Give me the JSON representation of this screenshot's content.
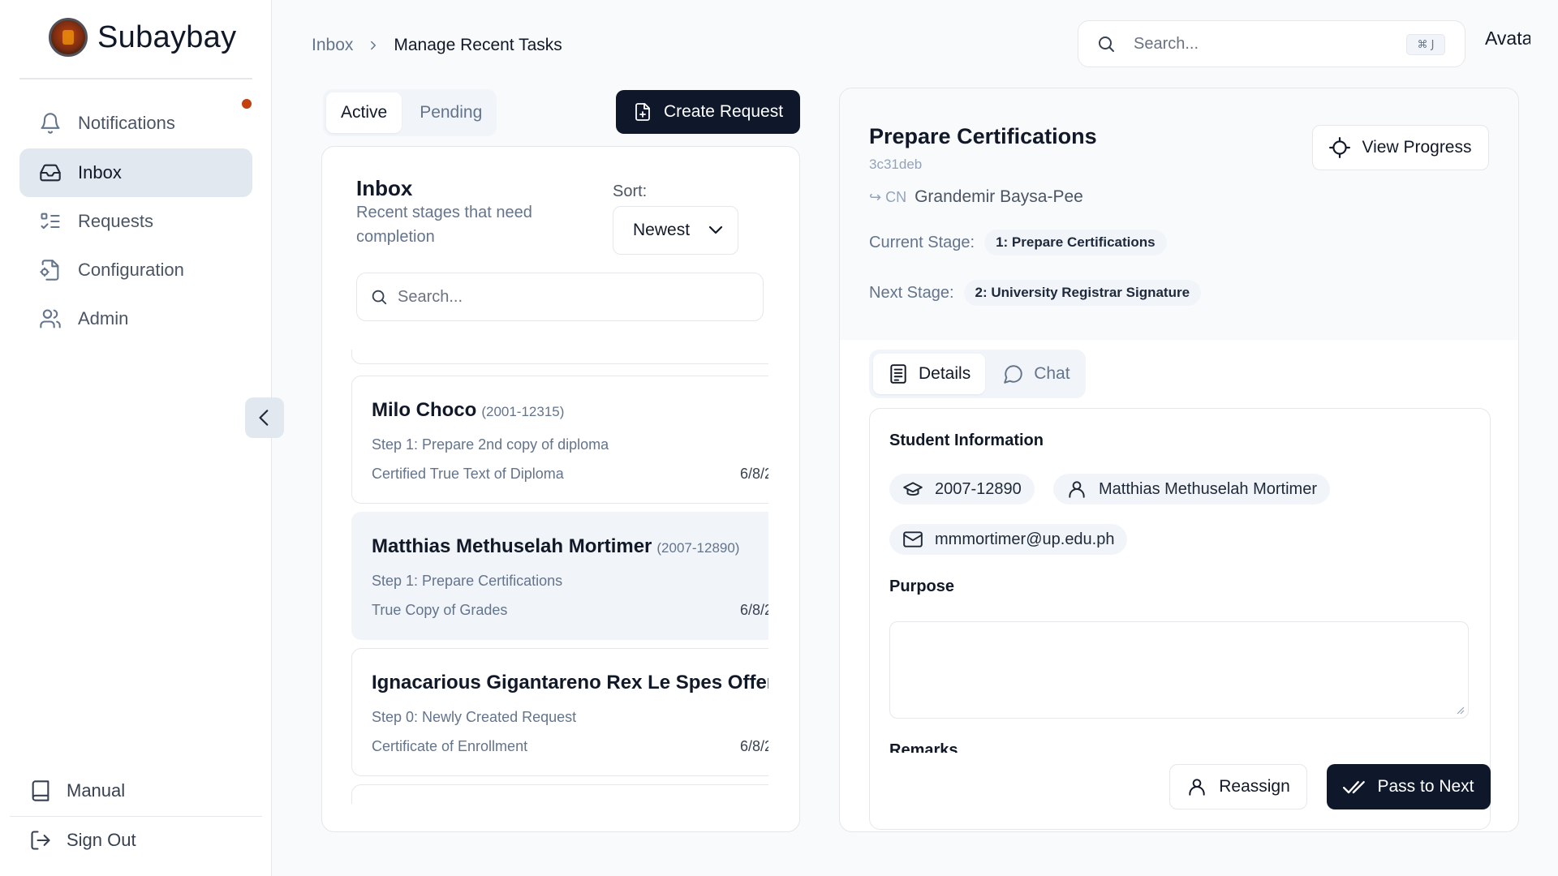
{
  "app": {
    "name": "Subaybay"
  },
  "sidebar": {
    "items": [
      {
        "label": "Notifications",
        "icon": "bell-icon"
      },
      {
        "label": "Inbox",
        "icon": "inbox-icon"
      },
      {
        "label": "Requests",
        "icon": "list-checks-icon"
      },
      {
        "label": "Configuration",
        "icon": "file-cog-icon"
      },
      {
        "label": "Admin",
        "icon": "users-icon"
      }
    ],
    "bottom": [
      {
        "label": "Manual",
        "icon": "book-icon"
      },
      {
        "label": "Sign Out",
        "icon": "sign-out-icon"
      }
    ],
    "notification_dot_color": "#c2410c"
  },
  "header": {
    "breadcrumb": [
      "Inbox",
      "Manage Recent Tasks"
    ],
    "search_placeholder": "Search...",
    "shortcut": "⌘ J",
    "avatar_text": "Avatar"
  },
  "tabs": [
    "Active",
    "Pending"
  ],
  "create_label": "Create Request",
  "inbox": {
    "title": "Inbox",
    "subtitle": "Recent stages that need completion",
    "sort_label": "Sort:",
    "sort_value": "Newest",
    "search_placeholder": "Search...",
    "items": [
      {
        "name": "Milo Choco",
        "id": "(2001-12315)",
        "step": "Step 1: Prepare 2nd copy of diploma",
        "doc": "Certified True Text of Diploma",
        "date": "6/8/2"
      },
      {
        "name": "Matthias Methuselah Mortimer",
        "id": "(2007-12890)",
        "step": "Step 1: Prepare Certifications",
        "doc": "True Copy of Grades",
        "date": "6/8/2"
      },
      {
        "name": "Ignacarious Gigantareno Rex Le Spes Offeren",
        "id": "",
        "step": "Step 0: Newly Created Request",
        "doc": "Certificate of Enrollment",
        "date": "6/8/2"
      }
    ]
  },
  "detail": {
    "title": "Prepare Certifications",
    "code": "3c31deb",
    "owner_tag": "↪ CN",
    "owner": "Grandemir Baysa-Pee",
    "view_progress": "View Progress",
    "current_stage_label": "Current Stage:",
    "current_stage": "1: Prepare Certifications",
    "next_stage_label": "Next Stage:",
    "next_stage": "2: University Registrar Signature",
    "tabs": [
      "Details",
      "Chat"
    ],
    "student_info_title": "Student Information",
    "student_number": "2007-12890",
    "student_name": "Matthias Methuselah Mortimer",
    "student_email": "mmmortimer@up.edu.ph",
    "purpose_title": "Purpose",
    "remarks_title": "Remarks",
    "reassign": "Reassign",
    "pass_next": "Pass to Next"
  }
}
